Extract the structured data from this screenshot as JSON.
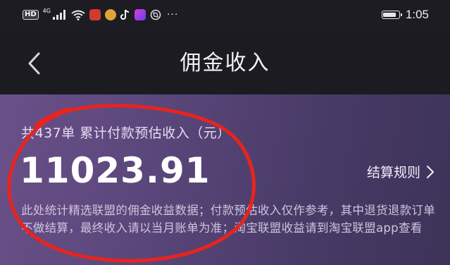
{
  "status_bar": {
    "hd": "HD",
    "network": "4G",
    "time": "1:05",
    "more": "···",
    "battery_level": 0.9,
    "icons": [
      "signal-icon",
      "wifi-icon",
      "app-icon-weibo",
      "app-icon-coin",
      "tiktok-icon",
      "video-app-icon",
      "browser-icon"
    ]
  },
  "header": {
    "title": "佣金收入",
    "back_icon": "chevron-left-icon"
  },
  "summary": {
    "order_line": "共437单 累计付款预估收入（元）",
    "amount": "11023.91",
    "rules_label": "结算规则",
    "rules_icon": "chevron-right-icon",
    "notice": "此处统计精选联盟的佣金收益数据；付款预估收入仅作参考，其中退货退款订单不做结算，最终收入请以当月账单为准；淘宝联盟收益请到淘宝联盟app查看"
  },
  "annotation": {
    "color": "#e8241e"
  },
  "colors": {
    "background": "#1b1b21",
    "card_start": "#6a5088",
    "card_end": "#3d3358"
  }
}
